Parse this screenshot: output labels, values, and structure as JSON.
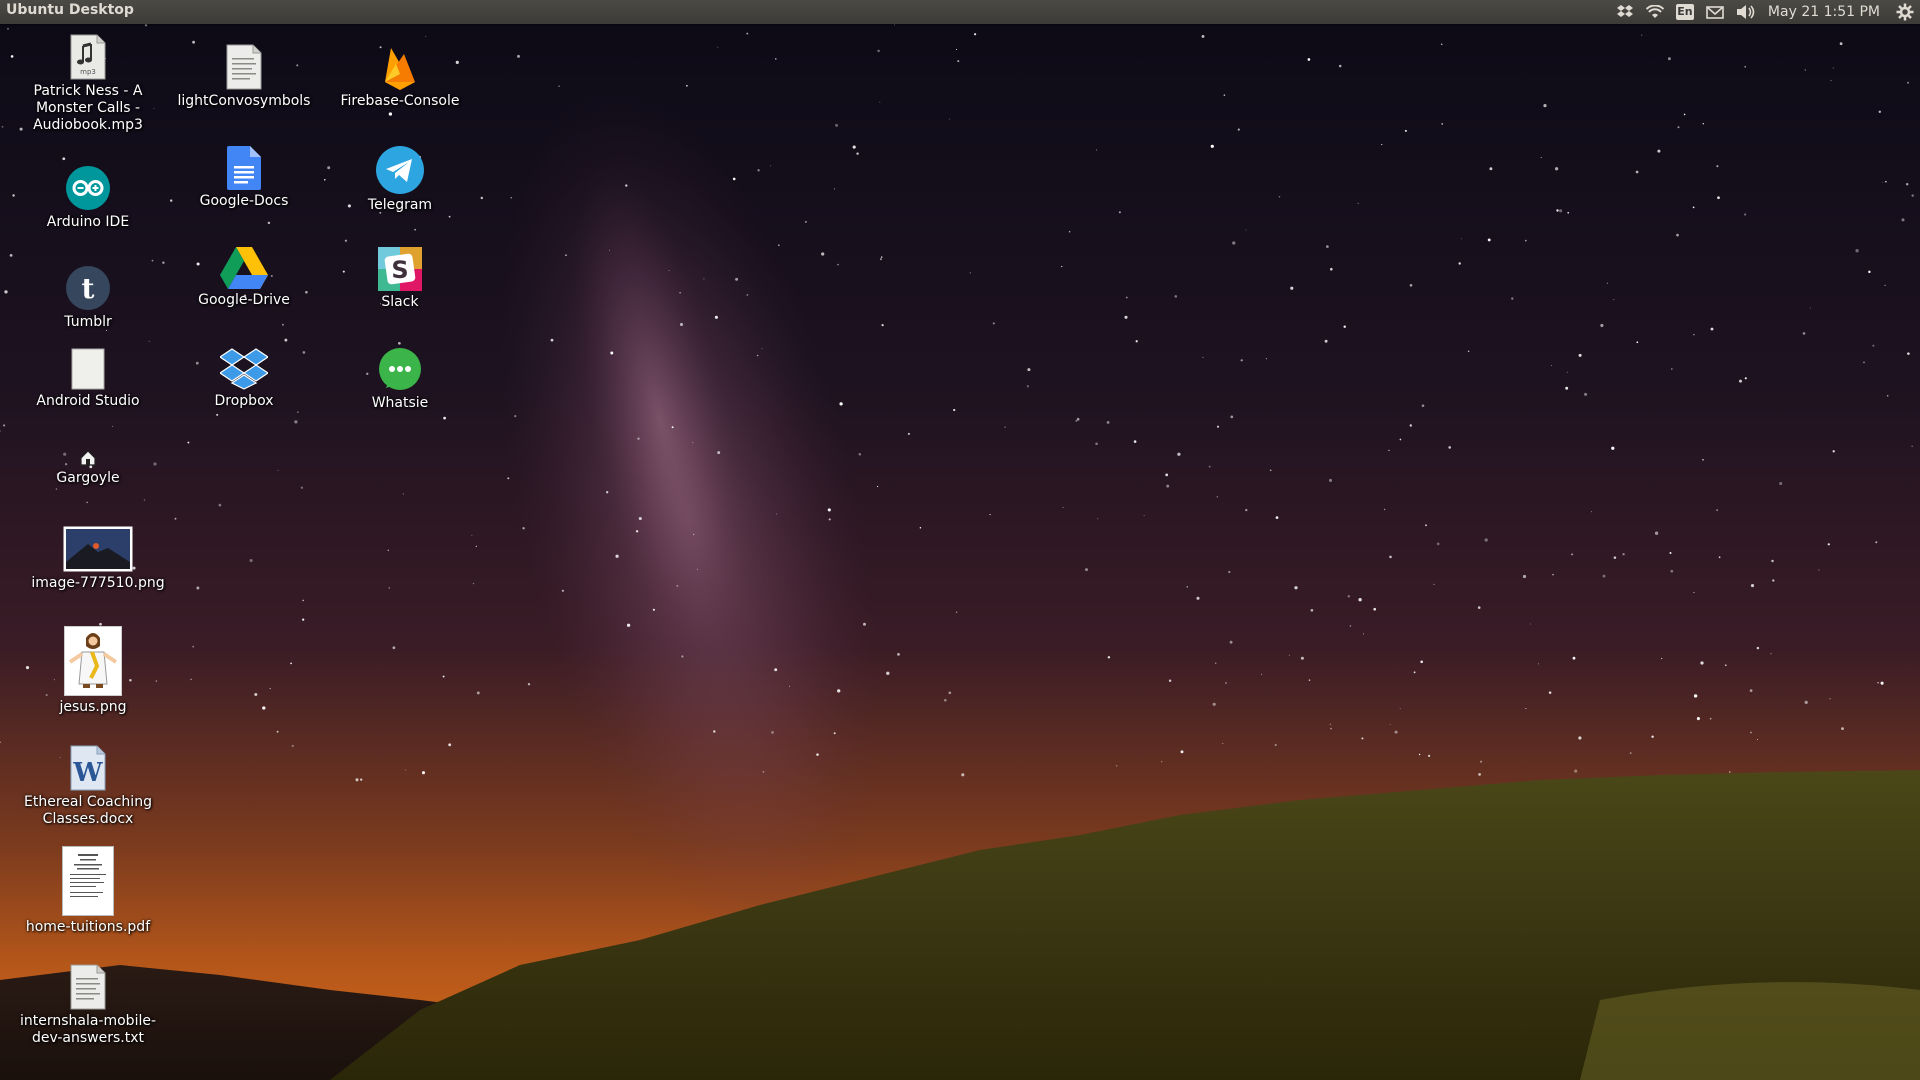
{
  "panel": {
    "title": "Ubuntu Desktop",
    "clock": "May 21  1:51 PM",
    "language": "En",
    "indicators": [
      "dropbox-icon",
      "wifi-icon",
      "keyboard-layout-icon",
      "mail-icon",
      "volume-icon",
      "session-gear-icon"
    ]
  },
  "desktop": {
    "icons": {
      "audiobook": {
        "label": "Patrick Ness - A\nMonster Calls -\nAudiobook.mp3",
        "icon": "mp3-file-icon"
      },
      "arduino": {
        "label": "Arduino IDE",
        "icon": "arduino-icon"
      },
      "tumblr": {
        "label": "Tumblr",
        "icon": "tumblr-icon"
      },
      "android_studio": {
        "label": "Android Studio",
        "icon": "blank-file-icon"
      },
      "gargoyle": {
        "label": "Gargoyle",
        "icon": "gargoyle-icon"
      },
      "image_png": {
        "label": "image-777510.png",
        "icon": "image-thumbnail-icon"
      },
      "jesus_png": {
        "label": "jesus.png",
        "icon": "image-thumbnail-icon"
      },
      "docx": {
        "label": "Ethereal Coaching\nClasses.docx",
        "icon": "word-document-icon"
      },
      "pdf": {
        "label": "home-tuitions.pdf",
        "icon": "pdf-document-icon"
      },
      "txt": {
        "label": "internshala-mobile-\ndev-answers.txt",
        "icon": "text-file-icon"
      },
      "lightconvo": {
        "label": "lightConvosymbols",
        "icon": "text-file-icon"
      },
      "google_docs": {
        "label": "Google-Docs",
        "icon": "google-docs-icon"
      },
      "google_drive": {
        "label": "Google-Drive",
        "icon": "google-drive-icon"
      },
      "dropbox": {
        "label": "Dropbox",
        "icon": "dropbox-icon"
      },
      "firebase": {
        "label": "Firebase-Console",
        "icon": "firebase-icon"
      },
      "telegram": {
        "label": "Telegram",
        "icon": "telegram-icon"
      },
      "slack": {
        "label": "Slack",
        "icon": "slack-icon"
      },
      "whatsie": {
        "label": "Whatsie",
        "icon": "whatsie-icon"
      }
    }
  },
  "colors": {
    "panel_bg": "#3c3b37",
    "panel_text": "#dfdbd2",
    "sky_top": "#0d0b17",
    "sky_horizon": "#c8621c",
    "hill": "#3d3a1a"
  }
}
